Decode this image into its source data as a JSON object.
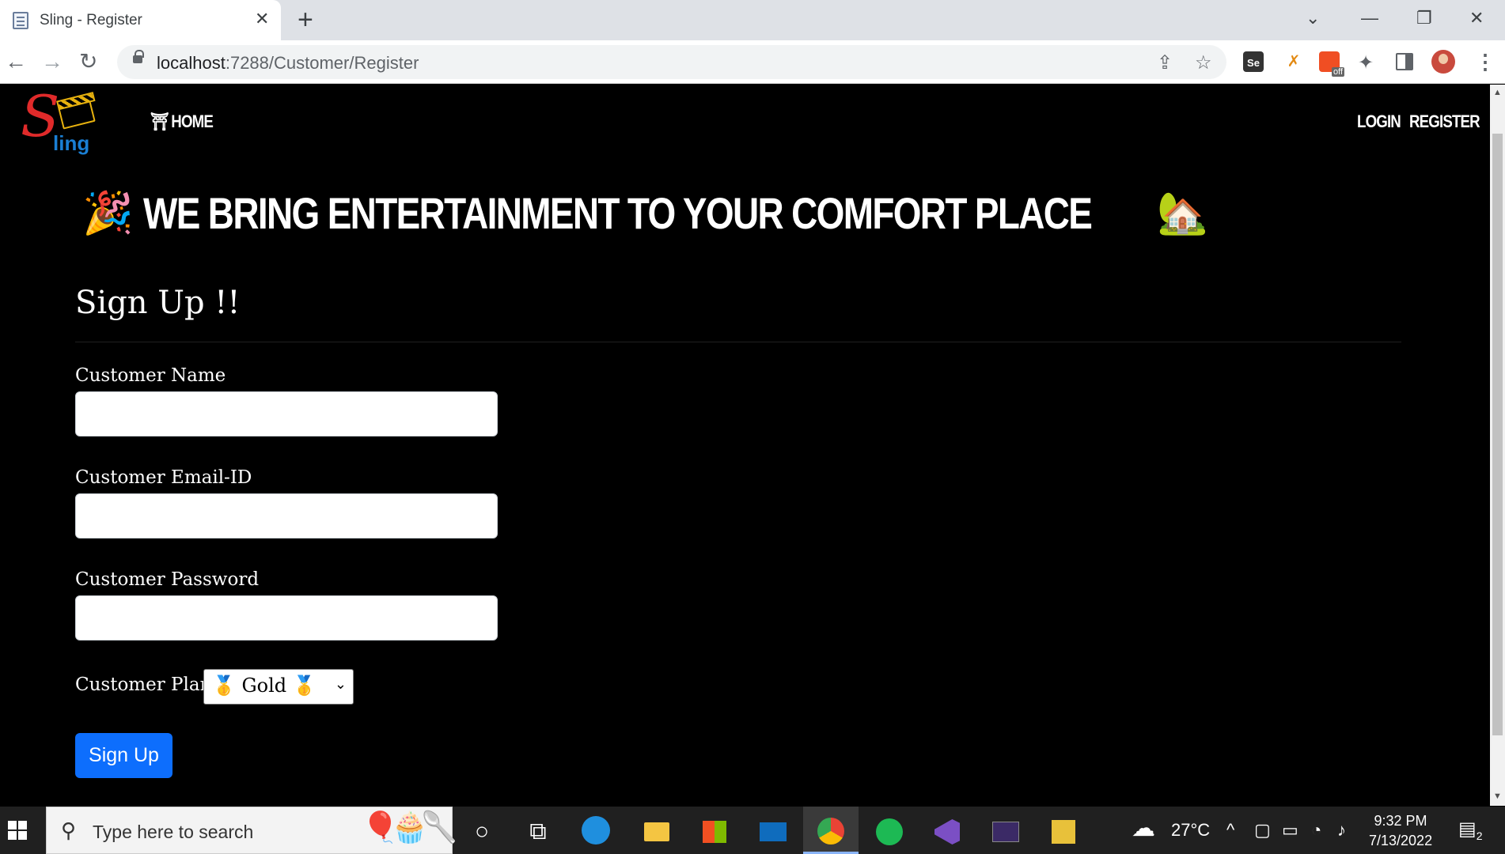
{
  "browser": {
    "tab_title": "Sling - Register",
    "tab_close": "✕",
    "new_tab": "+",
    "url_host": "localhost",
    "url_rest": ":7288/Customer/Register",
    "controls": {
      "dropdown": "⌄",
      "minimize": "—",
      "restore": "❐",
      "close": "✕"
    },
    "nav": {
      "back": "←",
      "forward": "→",
      "reload": "↻"
    },
    "omnibox_icons": {
      "share": "⇪",
      "bookmark": "☆"
    },
    "extensions": {
      "se": "Se",
      "x": "✗",
      "off_badge": "off",
      "puzzle": "✦",
      "menu": "⋮"
    }
  },
  "site": {
    "logo_s": "S",
    "logo_ling": "ling",
    "nav_home_icon": "⛩",
    "nav_home": "HOME",
    "nav_login": "LOGIN",
    "nav_register": "REGISTER",
    "headline_left_emoji": "🎉",
    "headline": "WE BRING ENTERTAINMENT TO YOUR COMFORT PLACE",
    "headline_right_emoji": "🏡"
  },
  "form": {
    "title": "Sign Up !!",
    "name_label": "Customer Name",
    "name_value": "",
    "email_label": "Customer Email-ID",
    "email_value": "",
    "password_label": "Customer Password",
    "password_value": "",
    "plan_label": "Customer Plan",
    "plan_selected": "🥇 Gold 🥇",
    "plan_chevron": "⌄",
    "submit_label": "Sign Up"
  },
  "taskbar": {
    "search_placeholder": "Type here to search",
    "search_glyph": "⚲",
    "search_art": "🎈🧁🥄",
    "cortana": "○",
    "taskview": "⧉",
    "apps": [
      "edge-icon",
      "file-explorer-icon",
      "store-icon",
      "mail-icon",
      "chrome-icon",
      "spotify-icon",
      "visual-studio-icon",
      "terminal-icon",
      "tools-icon"
    ],
    "weather_icon": "☁",
    "temperature": "27°C",
    "tray_chevron": "^",
    "time": "9:32 PM",
    "date": "7/13/2022",
    "notification_count": "2"
  },
  "colors": {
    "accent": "#0d6efd",
    "page_bg": "#000000",
    "logo_red": "#e02a2a",
    "logo_blue": "#1a7fd4",
    "logo_gold": "#e8b20e"
  }
}
